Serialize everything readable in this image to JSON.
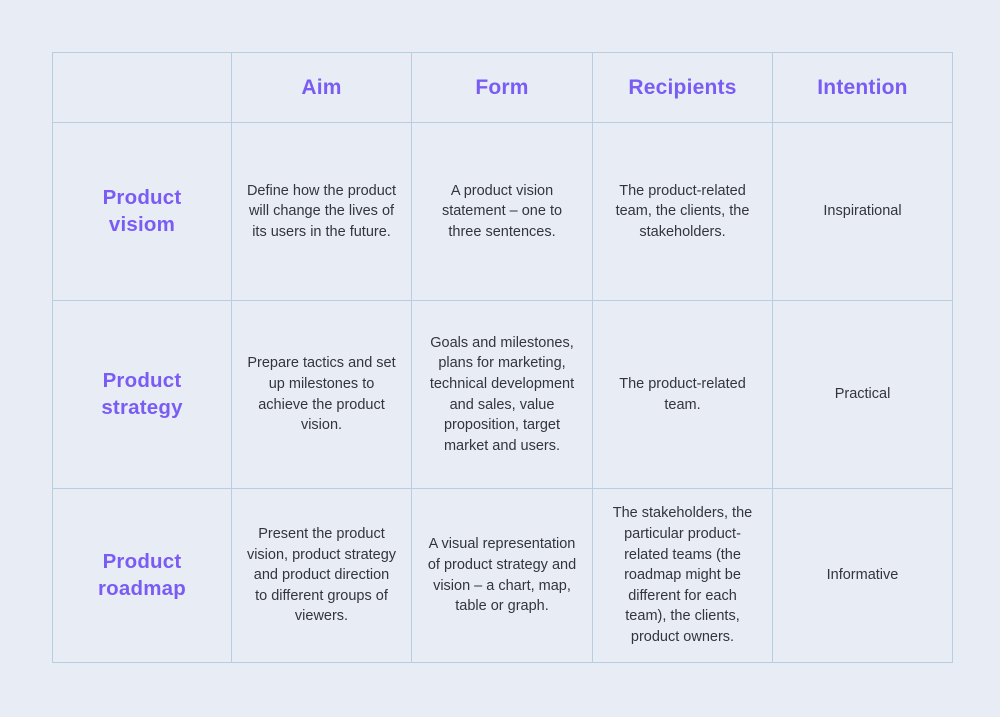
{
  "theme": {
    "page_background": "#e7ecf5",
    "cell_background": "#e8edf5",
    "border_color": "#b9cde1",
    "accent_purple": "#7a5cf5",
    "body_text_color": "#34343c"
  },
  "table": {
    "headers": {
      "corner": "",
      "aim": "Aim",
      "form": "Form",
      "recipients": "Recipients",
      "intention": "Intention"
    },
    "rows": [
      {
        "label": "Product visiom",
        "aim": "Define how the product will change the lives of its users in the future.",
        "form": "A product vision statement – one to three sentences.",
        "recipients": "The product-related team, the clients, the stakeholders.",
        "intention": "Inspirational"
      },
      {
        "label": "Product strategy",
        "aim": "Prepare tactics and set up milestones to achieve the product vision.",
        "form": "Goals and milestones, plans for marketing, technical development and sales, value proposition, target market and users.",
        "recipients": "The product-related team.",
        "intention": "Practical"
      },
      {
        "label": "Product roadmap",
        "aim": "Present the product vision, product strategy and product direction to different groups of viewers.",
        "form": "A visual representation of product strategy and vision – a chart, map, table or graph.",
        "recipients": "The stakeholders, the particular product-related teams (the roadmap might be different for each team), the clients, product owners.",
        "intention": "Informative"
      }
    ]
  }
}
